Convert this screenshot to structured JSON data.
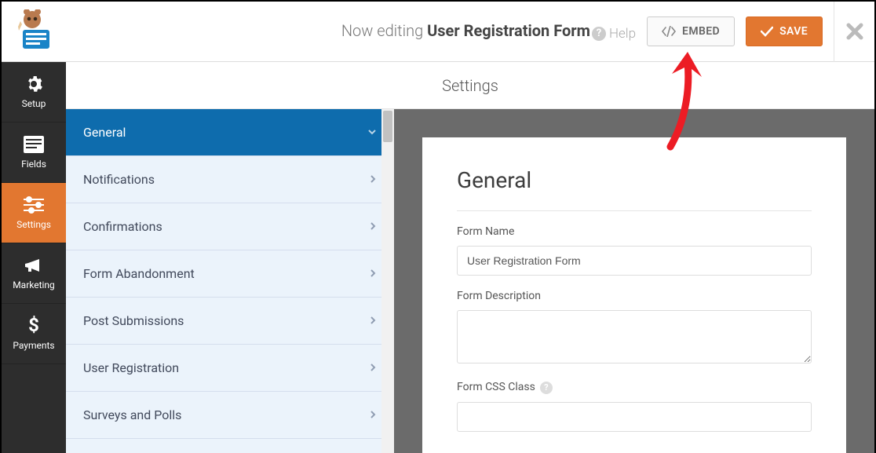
{
  "header": {
    "editing_prefix": "Now editing ",
    "form_title": "User Registration Form",
    "help_label": "Help",
    "embed_label": "EMBED",
    "save_label": "SAVE"
  },
  "leftnav": {
    "items": [
      {
        "label": "Setup",
        "icon": "gear"
      },
      {
        "label": "Fields",
        "icon": "list"
      },
      {
        "label": "Settings",
        "icon": "sliders",
        "active": true
      },
      {
        "label": "Marketing",
        "icon": "bullhorn"
      },
      {
        "label": "Payments",
        "icon": "dollar"
      }
    ]
  },
  "page_title": "Settings",
  "settings_menu": {
    "items": [
      {
        "label": "General",
        "active": true
      },
      {
        "label": "Notifications"
      },
      {
        "label": "Confirmations"
      },
      {
        "label": "Form Abandonment"
      },
      {
        "label": "Post Submissions"
      },
      {
        "label": "User Registration"
      },
      {
        "label": "Surveys and Polls"
      }
    ]
  },
  "panel": {
    "heading": "General",
    "fields": {
      "form_name_label": "Form Name",
      "form_name_value": "User Registration Form",
      "form_description_label": "Form Description",
      "form_description_value": "",
      "form_css_class_label": "Form CSS Class",
      "form_css_class_value": ""
    }
  },
  "colors": {
    "accent": "#e27730",
    "blue": "#0e6cad"
  }
}
